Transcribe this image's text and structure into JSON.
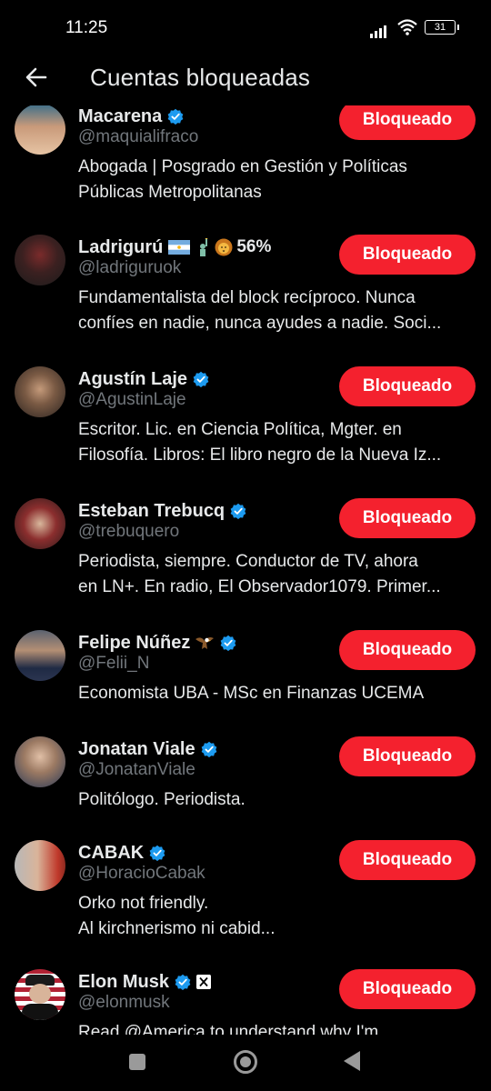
{
  "status": {
    "time": "11:25",
    "battery": "31"
  },
  "header": {
    "title": "Cuentas bloqueadas"
  },
  "button_label": "Bloqueado",
  "accounts": [
    {
      "name": "Macarena",
      "extra": "",
      "handle": "@maquialifraco",
      "bio": [
        "Abogada | Posgrado en Gestión y Políticas",
        "Públicas Metropolitanas"
      ]
    },
    {
      "name": "Ladrigurú",
      "extra": "56%",
      "handle": "@ladriguruok",
      "bio": [
        "Fundamentalista del block recíproco. Nunca",
        "confíes en nadie, nunca ayudes a nadie. Soci..."
      ]
    },
    {
      "name": "Agustín Laje",
      "extra": "",
      "handle": "@AgustinLaje",
      "bio": [
        "Escritor. Lic. en Ciencia Política, Mgter. en",
        "Filosofía. Libros: El libro negro de la Nueva Iz..."
      ]
    },
    {
      "name": "Esteban Trebucq",
      "extra": "",
      "handle": "@trebuquero",
      "bio": [
        "Periodista, siempre. Conductor de TV, ahora",
        "en LN+. En radio, El Observador1079. Primer..."
      ]
    },
    {
      "name": "Felipe Núñez",
      "extra": "",
      "handle": "@Felii_N",
      "bio": [
        "Economista UBA - MSc en Finanzas UCEMA"
      ]
    },
    {
      "name": "Jonatan Viale",
      "extra": "",
      "handle": "@JonatanViale",
      "bio": [
        "Politólogo. Periodista."
      ]
    },
    {
      "name": "CABAK",
      "extra": "",
      "handle": "@HoracioCabak",
      "bio": [
        "Orko not friendly.",
        "Al kirchnerismo ni cabid..."
      ]
    },
    {
      "name": "Elon Musk",
      "extra": "",
      "handle": "@elonmusk",
      "bio": [
        "Read @America to understand why I'm"
      ]
    }
  ]
}
